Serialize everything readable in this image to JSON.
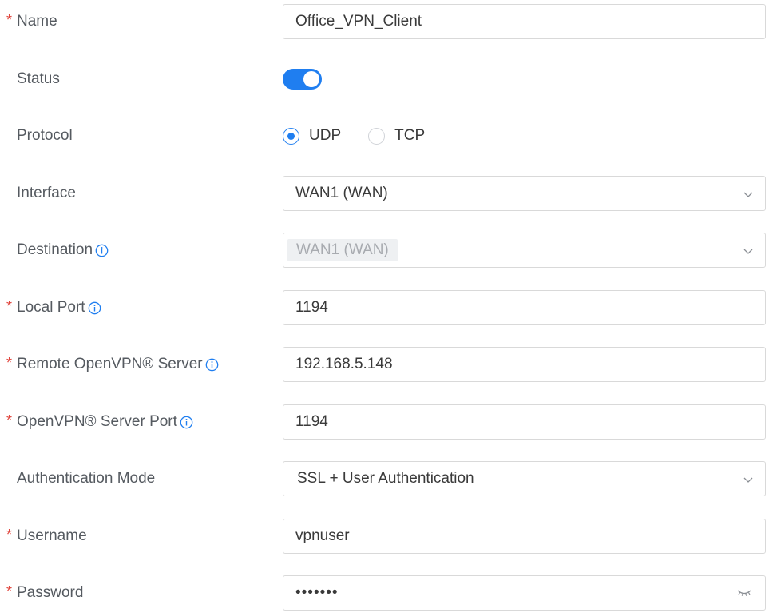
{
  "form": {
    "name": {
      "label": "Name",
      "required_mark": "*",
      "value": "Office_VPN_Client"
    },
    "status": {
      "label": "Status",
      "enabled": true
    },
    "protocol": {
      "label": "Protocol",
      "options": [
        {
          "label": "UDP",
          "selected": true
        },
        {
          "label": "TCP",
          "selected": false
        }
      ]
    },
    "interface": {
      "label": "Interface",
      "value": "WAN1 (WAN)"
    },
    "destination": {
      "label": "Destination",
      "value": "WAN1 (WAN)",
      "disabled": true
    },
    "local_port": {
      "label": "Local Port",
      "required_mark": "*",
      "value": "1194"
    },
    "remote_server": {
      "label": "Remote OpenVPN® Server",
      "required_mark": "*",
      "value": "192.168.5.148"
    },
    "server_port": {
      "label": "OpenVPN® Server Port",
      "required_mark": "*",
      "value": "1194"
    },
    "auth_mode": {
      "label": "Authentication Mode",
      "value": "SSL + User Authentication"
    },
    "username": {
      "label": "Username",
      "required_mark": "*",
      "value": "vpnuser"
    },
    "password": {
      "label": "Password",
      "required_mark": "*",
      "value": "•••••••"
    }
  },
  "icons": {
    "info": "info-circle-icon",
    "select": "chevron-down-icon",
    "password_toggle": "eye-closed-icon"
  },
  "colors": {
    "accent": "#1f7ef0",
    "required": "#e0443c",
    "label": "#555a60",
    "border": "#d9d9d9"
  }
}
